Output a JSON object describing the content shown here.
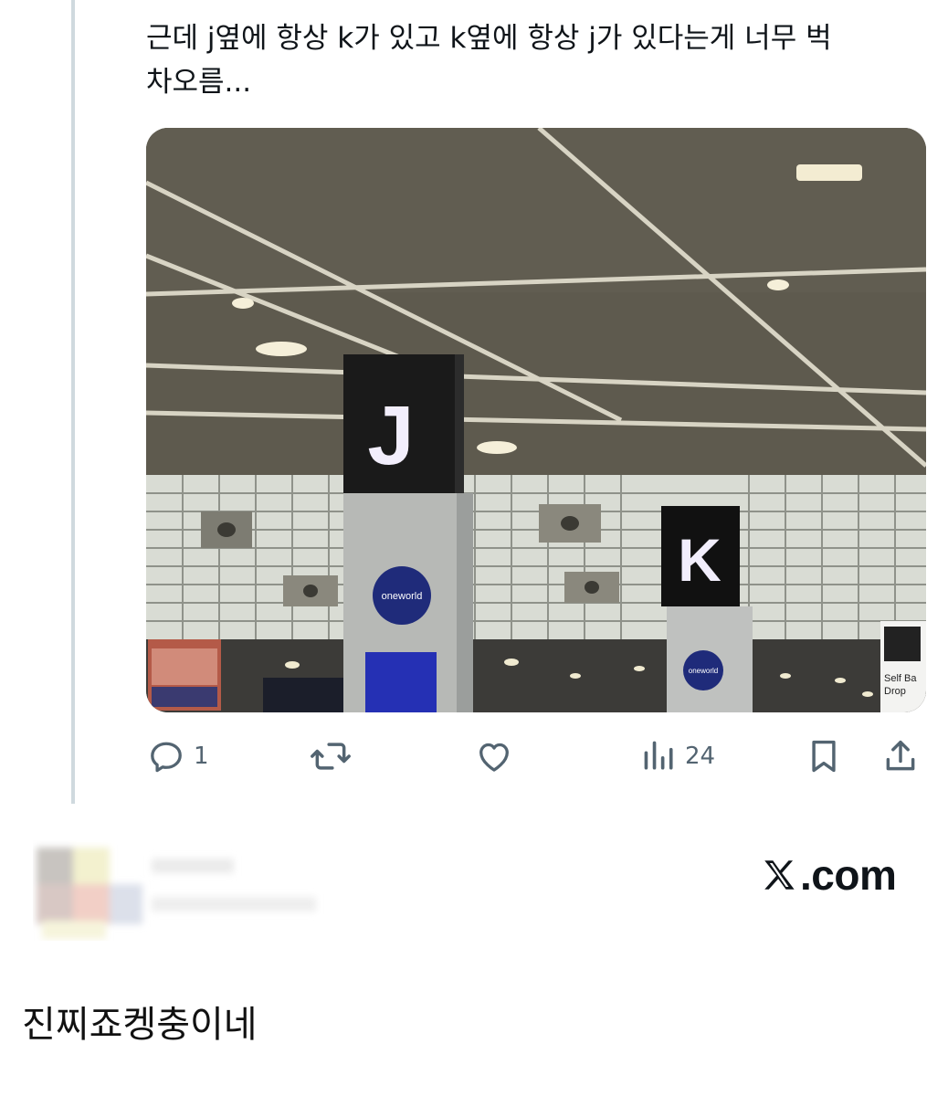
{
  "tweet": {
    "text": "근데 j옆에 항상 k가 있고 k옆에 항상 j가 있다는게 너무 벅\n차오름...",
    "media": {
      "signs": [
        "J",
        "K"
      ],
      "sign_caption": "oneworld",
      "kiosk_text": "Self Ba\nDrop"
    },
    "actions": {
      "reply": {
        "icon": "reply-icon",
        "count": "1"
      },
      "retweet": {
        "icon": "retweet-icon",
        "count": ""
      },
      "like": {
        "icon": "heart-icon",
        "count": ""
      },
      "views": {
        "icon": "views-icon",
        "count": "24"
      },
      "bookmark": {
        "icon": "bookmark-icon"
      },
      "share": {
        "icon": "share-icon"
      }
    }
  },
  "watermark": {
    "logo_text": ".com",
    "logo_icon": "x-logo-icon"
  },
  "comment": {
    "text": "진찌죠켕충이네"
  },
  "colors": {
    "icon_gray": "#536471",
    "text": "#0f1419",
    "thread_line": "#cfd9de"
  }
}
